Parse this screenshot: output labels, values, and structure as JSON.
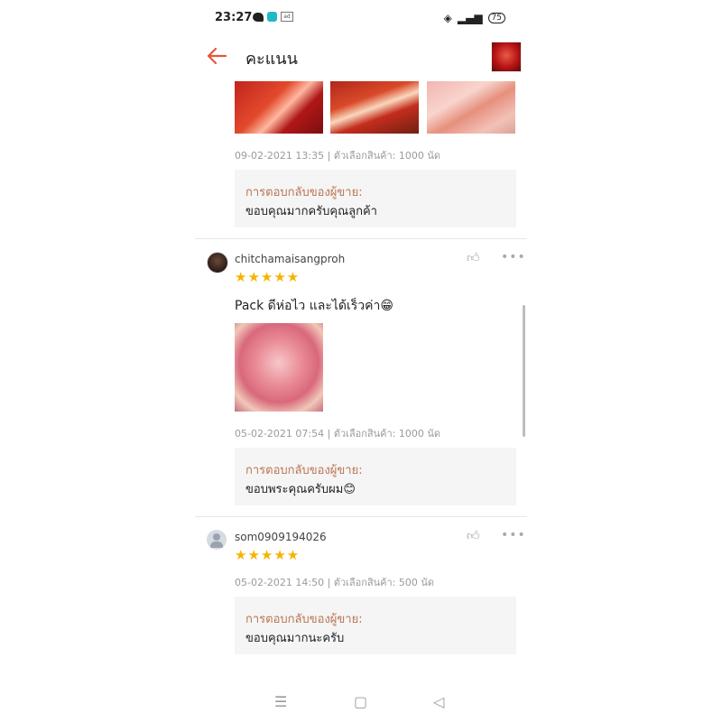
{
  "status": {
    "time": "23:27",
    "battery": "75",
    "small_box": "ad"
  },
  "header": {
    "title": "คะแนน"
  },
  "review0": {
    "meta": "09-02-2021 13:35 | ตัวเลือกสินค้า: 1000 นัด",
    "reply_label": "การตอบกลับของผู้ขาย:",
    "reply_text": "ขอบคุณมากครับคุณลูกค้า"
  },
  "review1": {
    "username": "chitchamaisangproh",
    "stars": "★★★★★",
    "text": "Pack ดีห่อไว และได้เร็วค่า😁",
    "meta": "05-02-2021 07:54 | ตัวเลือกสินค้า: 1000 นัด",
    "reply_label": "การตอบกลับของผู้ขาย:",
    "reply_text": "ขอบพระคุณครับผม😊"
  },
  "review2": {
    "username": "som0909194026",
    "stars": "★★★★★",
    "meta": "05-02-2021 14:50 | ตัวเลือกสินค้า: 500 นัด",
    "reply_label": "การตอบกลับของผู้ขาย:",
    "reply_text": "ขอบคุณมากนะครับ"
  },
  "icons": {
    "back": "arrow-left-icon",
    "like": "thumbs-up-icon",
    "more": "more-dots-icon",
    "nav_menu": "recent-apps-icon",
    "nav_home": "home-icon",
    "nav_back": "back-triangle-icon"
  },
  "colors": {
    "accent": "#e8553b",
    "star": "#f5b301",
    "reply_label": "#b97552",
    "reply_bg": "#f5f5f5"
  }
}
